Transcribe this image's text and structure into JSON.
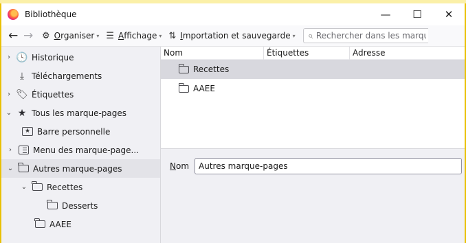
{
  "window": {
    "title": "Bibliothèque"
  },
  "toolbar": {
    "organiser": {
      "accel": "O",
      "rest": "rganiser"
    },
    "affichage": {
      "accel": "A",
      "rest": "ffichage"
    },
    "import": {
      "accel": "I",
      "rest": "mportation et sauvegarde"
    },
    "search_placeholder": "Rechercher dans les marque-pages"
  },
  "sidebar": {
    "items": [
      {
        "label": "Historique"
      },
      {
        "label": "Téléchargements"
      },
      {
        "label": "Étiquettes"
      },
      {
        "label": "Tous les marque-pages"
      },
      {
        "label": "Barre personnelle"
      },
      {
        "label": "Menu des marque-page..."
      },
      {
        "label": "Autres marque-pages"
      },
      {
        "label": "Recettes"
      },
      {
        "label": "Desserts"
      },
      {
        "label": "AAEE"
      }
    ]
  },
  "columns": {
    "name": "Nom",
    "tags": "Étiquettes",
    "address": "Adresse"
  },
  "list": {
    "rows": [
      {
        "name": "Recettes"
      },
      {
        "name": "AAEE"
      }
    ]
  },
  "details": {
    "name_label_accel": "N",
    "name_label_rest": "om",
    "name_value": "Autres marque-pages"
  }
}
